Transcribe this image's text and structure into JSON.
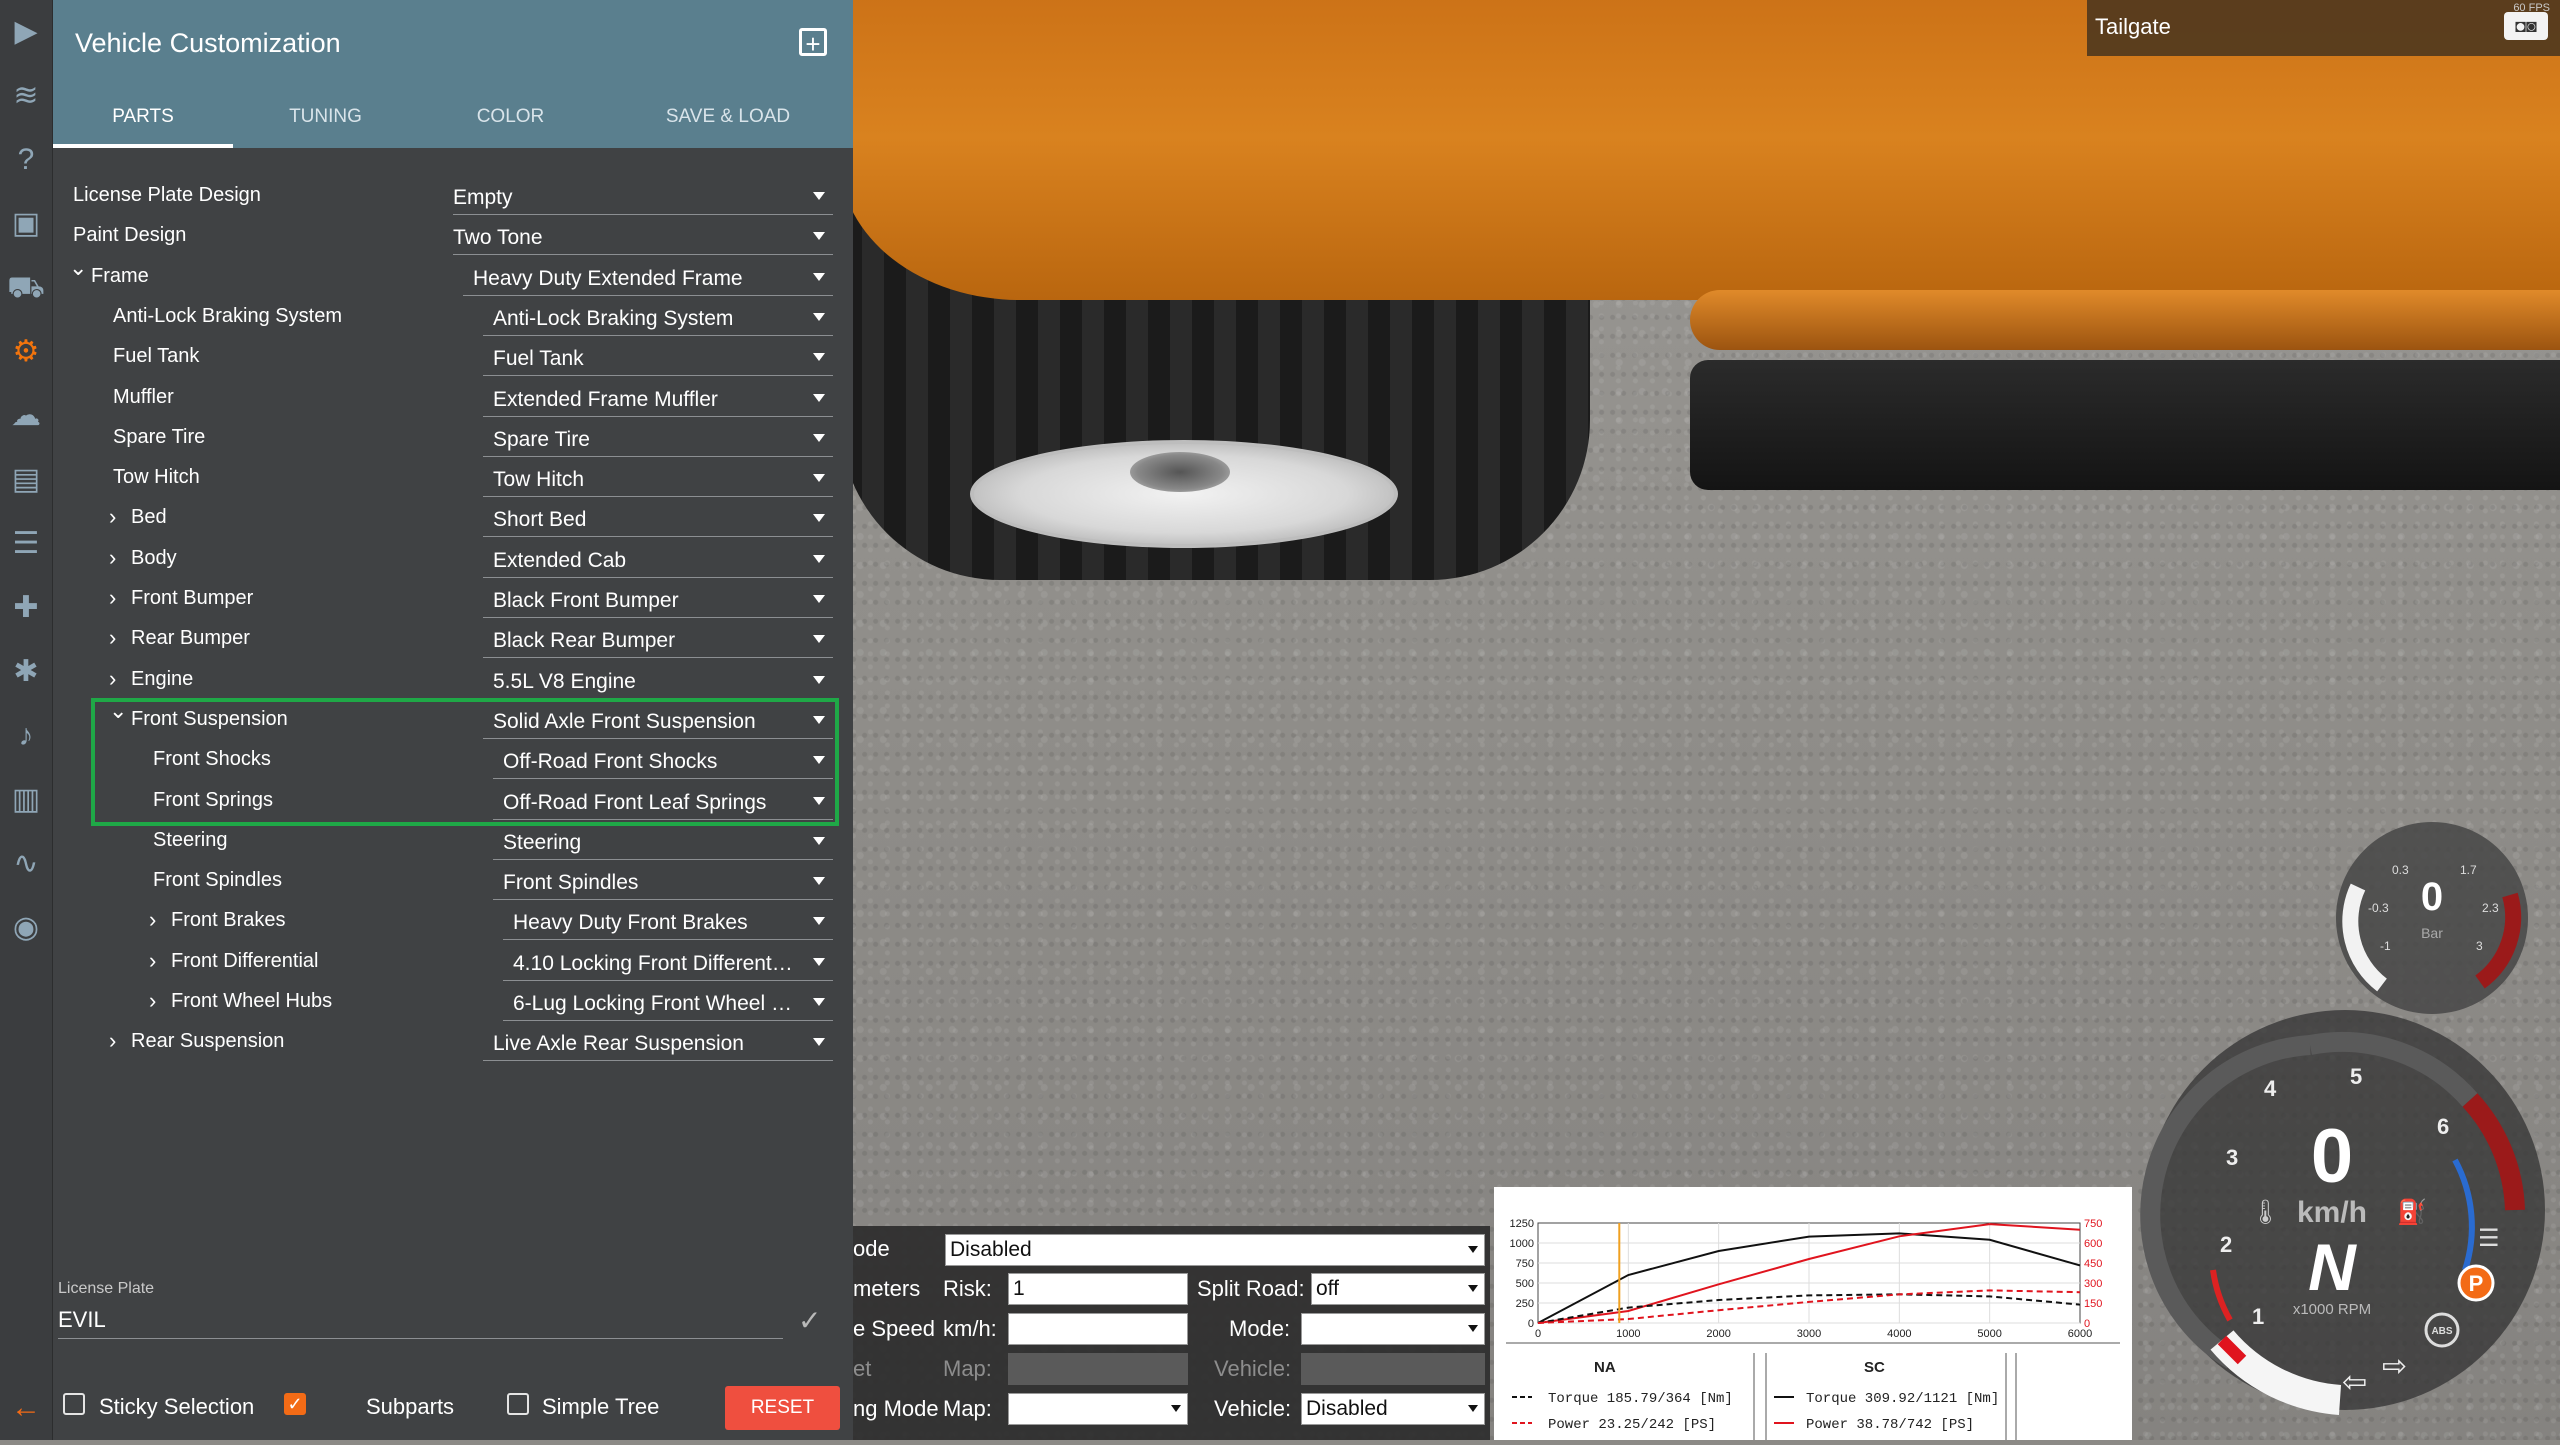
{
  "panel": {
    "title": "Vehicle Customization",
    "tabs": [
      {
        "label": "PARTS"
      },
      {
        "label": "TUNING"
      },
      {
        "label": "COLOR"
      },
      {
        "label": "SAVE & LOAD"
      }
    ],
    "rows": [
      {
        "label": "License Plate Design",
        "value": "Empty",
        "level": 0,
        "expander": ""
      },
      {
        "label": "Paint Design",
        "value": "Two Tone",
        "level": 0,
        "expander": ""
      },
      {
        "label": "Frame",
        "value": "Heavy Duty Extended Frame",
        "level": 0,
        "expander": "open"
      },
      {
        "label": "Anti-Lock Braking System",
        "value": "Anti-Lock Braking System",
        "level": 1,
        "expander": ""
      },
      {
        "label": "Fuel Tank",
        "value": "Fuel Tank",
        "level": 1,
        "expander": ""
      },
      {
        "label": "Muffler",
        "value": "Extended Frame Muffler",
        "level": 1,
        "expander": ""
      },
      {
        "label": "Spare Tire",
        "value": "Spare Tire",
        "level": 1,
        "expander": ""
      },
      {
        "label": "Tow Hitch",
        "value": "Tow Hitch",
        "level": 1,
        "expander": ""
      },
      {
        "label": "Bed",
        "value": "Short Bed",
        "level": 1,
        "expander": "closed"
      },
      {
        "label": "Body",
        "value": "Extended Cab",
        "level": 1,
        "expander": "closed"
      },
      {
        "label": "Front Bumper",
        "value": "Black Front Bumper",
        "level": 1,
        "expander": "closed"
      },
      {
        "label": "Rear Bumper",
        "value": "Black Rear Bumper",
        "level": 1,
        "expander": "closed"
      },
      {
        "label": "Engine",
        "value": "5.5L V8 Engine",
        "level": 1,
        "expander": "closed"
      },
      {
        "label": "Front Suspension",
        "value": "Solid Axle Front Suspension",
        "level": 1,
        "expander": "open"
      },
      {
        "label": "Front Shocks",
        "value": "Off-Road Front Shocks",
        "level": 2,
        "expander": ""
      },
      {
        "label": "Front Springs",
        "value": "Off-Road Front Leaf Springs",
        "level": 2,
        "expander": ""
      },
      {
        "label": "Steering",
        "value": "Steering",
        "level": 2,
        "expander": ""
      },
      {
        "label": "Front Spindles",
        "value": "Front Spindles",
        "level": 2,
        "expander": ""
      },
      {
        "label": "Front Brakes",
        "value": "Heavy Duty Front Brakes",
        "level": 2,
        "expander": "closed"
      },
      {
        "label": "Front Differential",
        "value": "4.10 Locking Front Different…",
        "level": 2,
        "expander": "closed"
      },
      {
        "label": "Front Wheel Hubs",
        "value": "6-Lug Locking Front Wheel …",
        "level": 2,
        "expander": "closed"
      },
      {
        "label": "Rear Suspension",
        "value": "Live Axle Rear Suspension",
        "level": 1,
        "expander": "closed"
      }
    ],
    "license_plate": {
      "label": "License Plate",
      "value": "EVIL"
    },
    "options": {
      "sticky_selection": {
        "label": "Sticky Selection",
        "checked": false
      },
      "subparts": {
        "label": "Subparts",
        "checked": true
      },
      "simple_tree": {
        "label": "Simple Tree",
        "checked": false
      }
    },
    "reset_label": "RESET"
  },
  "part_label": {
    "text": "Tailgate",
    "fps": "60 FPS"
  },
  "debug": {
    "mode_label": "ode",
    "mode_value": "Disabled",
    "params_label": "meters",
    "risk_label": "Risk:",
    "risk_value": "1",
    "split_label": "Split Road:",
    "split_value": "off",
    "speed_label": "e Speed",
    "kmh_label": "km/h:",
    "kmh_value": "",
    "mode2_label": "Mode:",
    "mode2_value": "",
    "set_label": "et",
    "map_label": "Map:",
    "map_value": "",
    "vehicle_label": "Vehicle:",
    "vehicle_value": "",
    "ngmode_label": "ng Mode",
    "map2_label": "Map:",
    "map2_value": "",
    "vehicle2_label": "Vehicle:",
    "vehicle2_value": "Disabled"
  },
  "graph": {
    "left_ticks": [
      "1250",
      "1000",
      "750",
      "500",
      "250",
      "0"
    ],
    "right_ticks": [
      "750",
      "600",
      "450",
      "300",
      "150",
      "0"
    ],
    "x_ticks": [
      "0",
      "1000",
      "2000",
      "3000",
      "4000",
      "5000",
      "6000"
    ],
    "na": {
      "title": "NA",
      "torque": "Torque 185.79/364 [Nm]",
      "power": "Power  23.25/242  [PS]"
    },
    "sc": {
      "title": "SC",
      "torque": "Torque 309.92/1121 [Nm]",
      "power": "Power  38.78/742  [PS]"
    },
    "colors": {
      "torque": "#111111",
      "power": "#e0141e",
      "marker": "#f0a020"
    }
  },
  "chart_data": {
    "type": "line",
    "x": [
      0,
      1000,
      2000,
      3000,
      4000,
      5000,
      6000
    ],
    "series": [
      {
        "name": "Torque",
        "values": [
          0,
          600,
          900,
          1080,
          1120,
          1040,
          720
        ]
      },
      {
        "name": "Power",
        "values": [
          0,
          90,
          290,
          480,
          650,
          742,
          700
        ]
      }
    ],
    "xlim": [
      0,
      6000
    ],
    "ylim": [
      0,
      1250
    ]
  },
  "gauges": {
    "boost": {
      "value": "0",
      "unit": "Bar",
      "ticks": [
        "0.3",
        "1.7",
        "-0.3",
        "2.3",
        "-1",
        "3"
      ]
    },
    "speed": {
      "value": "0",
      "unit": "km/h",
      "gear": "N",
      "rpm_unit": "x1000 RPM",
      "rpm_ticks": [
        "1",
        "2",
        "3",
        "4",
        "5",
        "6"
      ],
      "parking": "P",
      "abs": "ABS"
    }
  }
}
